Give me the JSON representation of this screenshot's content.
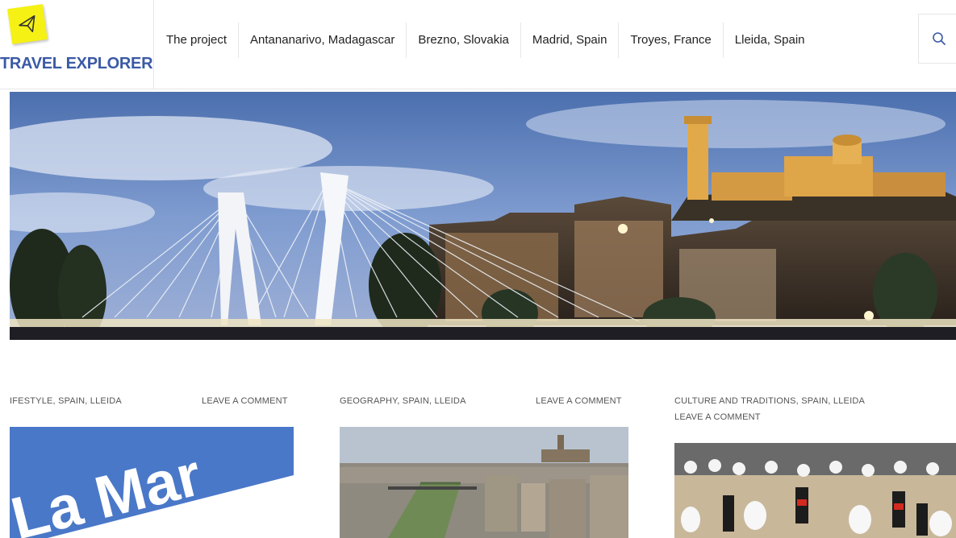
{
  "site": {
    "title": "TRAVEL EXPLORER",
    "logo_icon": "airplane-icon",
    "logo_color": "#f5f115",
    "title_color": "#3b5aa6"
  },
  "nav": {
    "items": [
      {
        "label": "The project"
      },
      {
        "label": "Antananarivo, Madagascar"
      },
      {
        "label": "Brezno, Slovakia"
      },
      {
        "label": "Madrid, Spain"
      },
      {
        "label": "Troyes, France"
      },
      {
        "label": "Lleida, Spain"
      }
    ],
    "search_icon": "search-icon"
  },
  "posts": [
    {
      "categories": "IFESTYLE, SPAIN, LLEIDA",
      "comment": "LEAVE A COMMENT",
      "thumb_text": "La Mar"
    },
    {
      "categories": "GEOGRAPHY, SPAIN, LLEIDA",
      "comment": "LEAVE A COMMENT"
    },
    {
      "categories": "CULTURE AND TRADITIONS, SPAIN, LLEIDA",
      "comment": "LEAVE A COMMENT"
    }
  ]
}
